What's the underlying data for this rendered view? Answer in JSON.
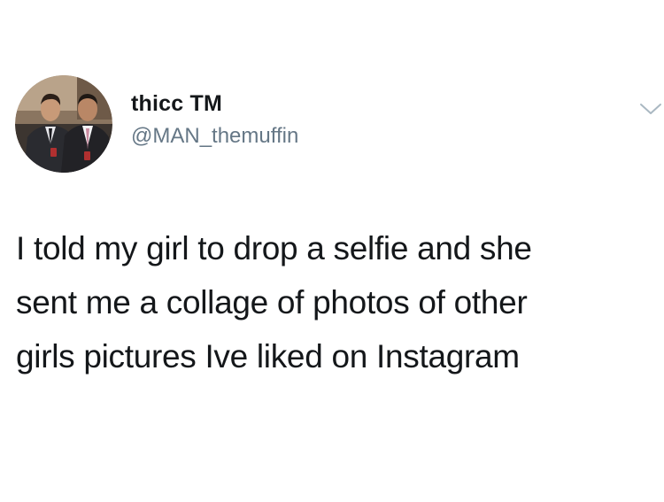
{
  "tweet": {
    "author": {
      "display_name": "thicc TM",
      "handle": "@MAN_themuffin",
      "avatar_icon": "profile-photo-two-men-in-suits"
    },
    "menu_icon": "chevron-down-icon",
    "text": "I told my girl to drop a selfie and she\nsent me a collage of photos of other\ngirls pictures Ive liked on Instagram"
  },
  "colors": {
    "background": "#ffffff",
    "text_primary": "#14171a",
    "text_secondary": "#657786",
    "caret": "#aab8c2"
  }
}
